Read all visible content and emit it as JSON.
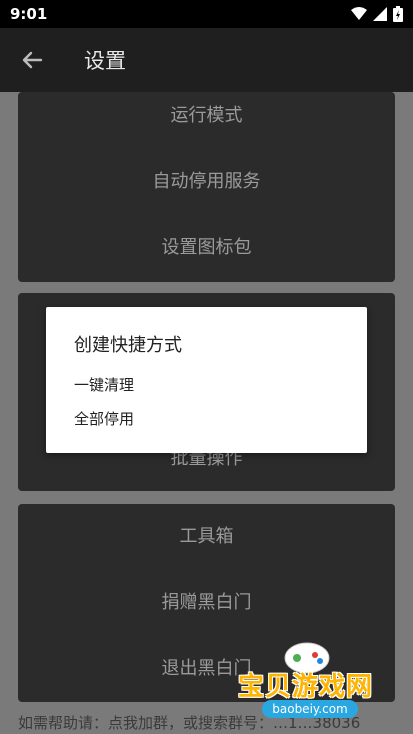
{
  "status_bar": {
    "time": "9:01"
  },
  "app_bar": {
    "title": "设置"
  },
  "cards": {
    "card1": [
      "运行模式",
      "自动停用服务",
      "设置图标包"
    ],
    "card2": [
      "批量操作"
    ],
    "card3": [
      "工具箱",
      "捐赠黑白门",
      "退出黑白门"
    ]
  },
  "dialog": {
    "title": "创建快捷方式",
    "options": [
      "一键清理",
      "全部停用"
    ]
  },
  "footer": {
    "help_text": "如需帮助请：点我加群，或搜索群号：…1…38036"
  },
  "watermark": {
    "logo_text": "宝贝游戏网",
    "url": "baobeiy.com"
  },
  "colors": {
    "scrim": "#7a7a7a",
    "card": "#2b2b2b",
    "app_bar": "#1f1f1f"
  }
}
